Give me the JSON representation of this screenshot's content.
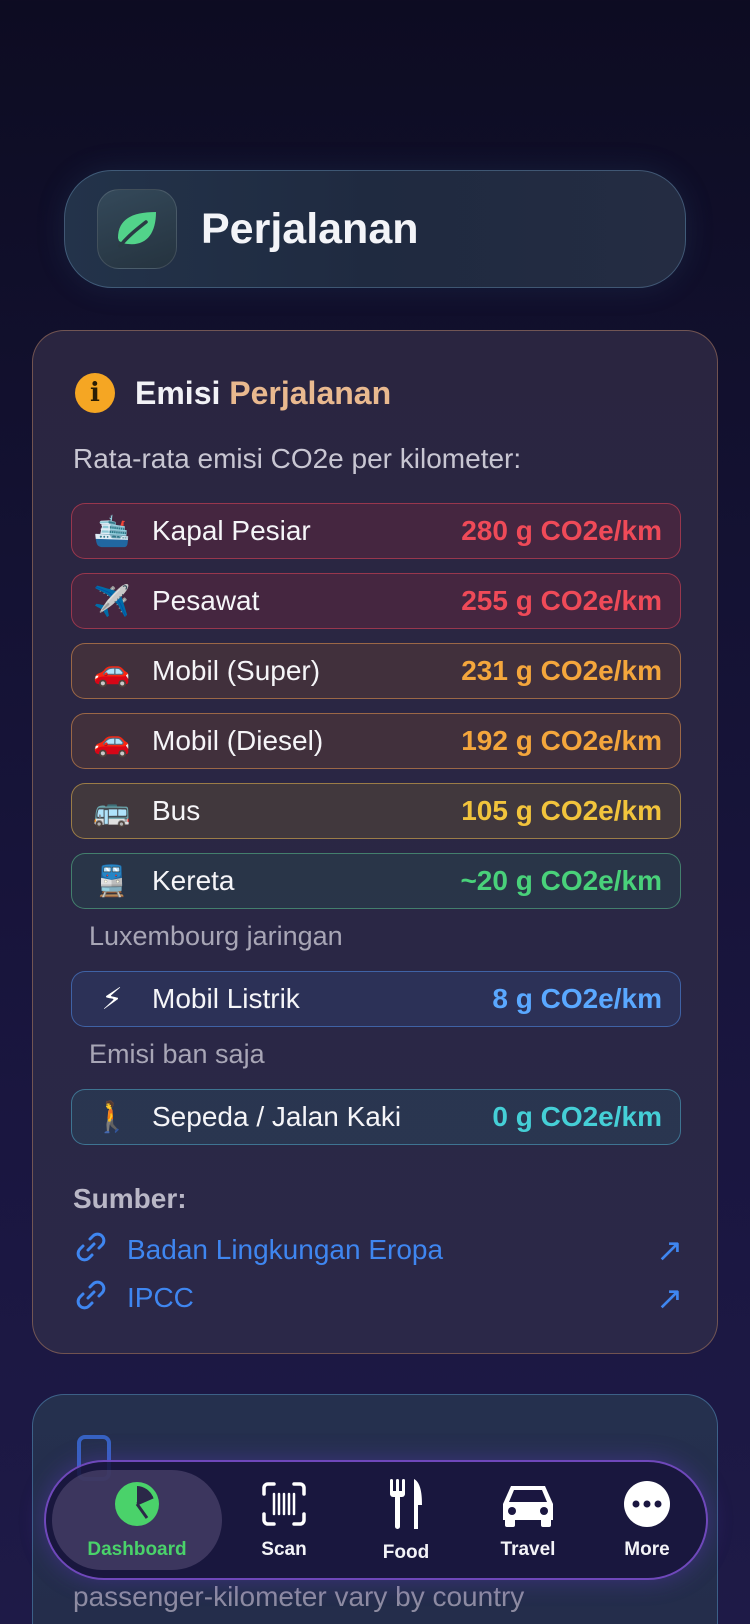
{
  "header": {
    "title": "Perjalanan",
    "icon": "leaf-icon"
  },
  "card": {
    "title_part1": "Emisi",
    "title_part2": "Perjalanan",
    "subtitle": "Rata-rata emisi CO2e per kilometer:",
    "rows": [
      {
        "emoji": "🛳️",
        "icon": "cruise-ship-icon",
        "name": "Kapal Pesiar",
        "value": "280 g CO2e/km"
      },
      {
        "emoji": "✈️",
        "icon": "airplane-icon",
        "name": "Pesawat",
        "value": "255 g CO2e/km"
      },
      {
        "emoji": "🚗",
        "icon": "car-icon",
        "name": "Mobil (Super)",
        "value": "231 g CO2e/km"
      },
      {
        "emoji": "🚗",
        "icon": "car-icon",
        "name": "Mobil (Diesel)",
        "value": "192 g CO2e/km"
      },
      {
        "emoji": "🚌",
        "icon": "bus-icon",
        "name": "Bus",
        "value": "105 g CO2e/km"
      },
      {
        "emoji": "🚆",
        "icon": "train-icon",
        "name": "Kereta",
        "value": "~20 g CO2e/km"
      },
      {
        "emoji": "⚡",
        "icon": "lightning-icon",
        "name": "Mobil Listrik",
        "value": "8 g CO2e/km"
      },
      {
        "emoji": "🚶",
        "icon": "walking-icon",
        "name": "Sepeda / Jalan Kaki",
        "value": "0 g CO2e/km"
      }
    ],
    "notes": {
      "train": "Luxembourg jaringan",
      "ev": "Emisi ban saja"
    },
    "sources_title": "Sumber:",
    "sources": [
      {
        "label": "Badan Lingkungan Eropa"
      },
      {
        "label": "IPCC"
      }
    ]
  },
  "card2": {
    "text": "passenger-kilometer vary by country"
  },
  "nav": {
    "items": [
      {
        "label": "Dashboard",
        "icon": "pie-chart-icon",
        "active": true
      },
      {
        "label": "Scan",
        "icon": "barcode-scan-icon"
      },
      {
        "label": "Food",
        "icon": "fork-knife-icon"
      },
      {
        "label": "Travel",
        "icon": "car-icon"
      },
      {
        "label": "More",
        "icon": "more-dots-icon"
      }
    ]
  },
  "colors": {
    "accent_green": "#4ad26a",
    "red": "#ef4a58",
    "orange": "#f4a63c",
    "yellow": "#f2c43c",
    "green": "#49d17a",
    "blue": "#5aa8ff",
    "teal": "#45cfd6",
    "link": "#3f86f0"
  }
}
